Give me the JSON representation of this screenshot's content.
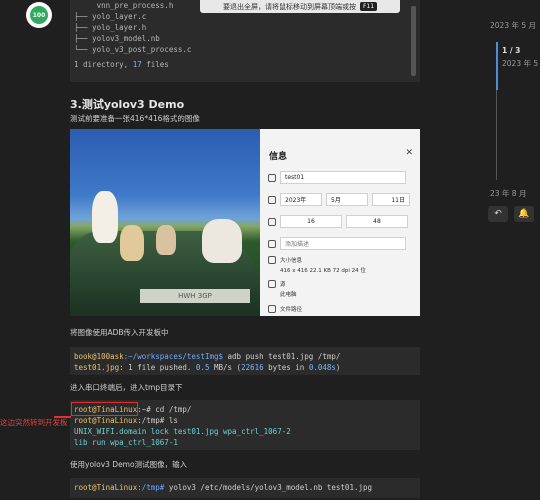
{
  "tooltip": {
    "text": "要退出全屏，请将鼠标移动到屏幕顶端或按",
    "key": "F11"
  },
  "avatar": {
    "text": "100"
  },
  "tree": {
    "lines": [
      "     vnn_pre_process.h",
      "├── yolo_layer.c",
      "├── yolo_layer.h",
      "├── yolov3_model.nb",
      "└── yolo_v3_post_process.c"
    ],
    "summary_pre": "1 directory, ",
    "summary_num": "17",
    "summary_post": " files"
  },
  "section": {
    "heading": "3.测试yolov3 Demo",
    "intro": "测试前要准备一张416*416格式的图像",
    "adb_text": "将图像使用ADB传入开发板中",
    "serial_text": "进入串口终端后，进入tmp目录下",
    "run_text": "使用yolov3 Demo测试图像，输入"
  },
  "photo": {
    "plate": "HWH 3GP"
  },
  "info": {
    "title": "信息",
    "name": "test01",
    "year": "2023年",
    "month": "5月",
    "day": "11日",
    "hour": "16",
    "minute": "48",
    "desc_placeholder": "添加描述",
    "size_label": "大小信息",
    "size_value": "416 x 416   22.1 KB   72 dpi   24 位",
    "source_label": "源",
    "source_value": "此电脑",
    "path_label": "文件路径"
  },
  "cmd1": {
    "user": "book@100ask",
    "path": ":~/workspaces/testImg$",
    "cmd": " adb push test01.jpg /tmp/",
    "out_file": "test01.jpg",
    "out_rest": ": 1 file pushed. ",
    "speed": "0.5",
    "speed_unit": " MB/s (",
    "bytes": "22616",
    "bytes_mid": " bytes in ",
    "secs": "0.048s",
    "close": ")"
  },
  "cmd2": {
    "prompt1": "root@TinaLinux",
    "rest1": ":~# cd /tmp/",
    "prompt2": "root@TinaLinux",
    "rest2": ":/tmp# ls",
    "out1": "UNIX_WIFI.domain lock test01.jpg wpa_ctrl_1067-2",
    "out2": "lib run wpa_ctrl_1067-1"
  },
  "cmd3": {
    "prompt": "root@TinaLinux",
    "path": ":/tmp#",
    "cmd": " yolov3 /etc/models/yolov3_model.nb test01.jpg"
  },
  "annotation": "这边突然转到开发板",
  "timeline": {
    "top_date": "2023 年 5 月",
    "count": "1 / 3",
    "sub_date": "2023 年 5",
    "bottom_date": "23 年 8 月"
  },
  "actions": {
    "reply_icon": "↶",
    "bell_icon": "🔔"
  }
}
